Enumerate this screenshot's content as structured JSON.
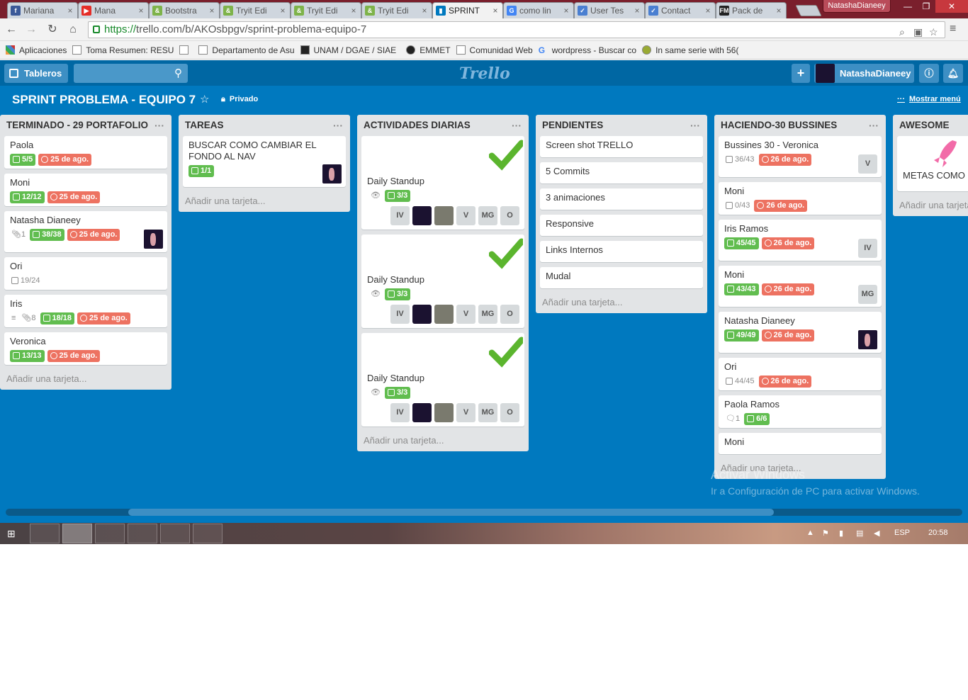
{
  "browser": {
    "tabs": [
      {
        "title": "Mariana",
        "fav": "f",
        "favcolor": "#3b5998"
      },
      {
        "title": "Mana",
        "fav": "▶",
        "favcolor": "#e52d27"
      },
      {
        "title": "Bootstra",
        "fav": "&",
        "favcolor": "#7eb34a"
      },
      {
        "title": "Tryit Edi",
        "fav": "&",
        "favcolor": "#7eb34a"
      },
      {
        "title": "Tryit Edi",
        "fav": "&",
        "favcolor": "#7eb34a"
      },
      {
        "title": "Tryit Edi",
        "fav": "&",
        "favcolor": "#7eb34a"
      },
      {
        "title": "SPRINT",
        "fav": "▮",
        "favcolor": "#0079bf"
      },
      {
        "title": "como lin",
        "fav": "G",
        "favcolor": "#4285f4"
      },
      {
        "title": "User Tes",
        "fav": "✓",
        "favcolor": "#4a7fd1"
      },
      {
        "title": "Contact",
        "fav": "✓",
        "favcolor": "#4a7fd1"
      },
      {
        "title": "Pack de",
        "fav": "FM",
        "favcolor": "#222222"
      }
    ],
    "profile_name": "NatashaDianeey",
    "url_scheme": "https://",
    "url_rest": "trello.com/b/AKOsbpgv/sprint-problema-equipo-7",
    "bookmarks": [
      "Aplicaciones",
      "Toma Resumen: RESU",
      "",
      "Departamento de Asu",
      "UNAM / DGAE / SIAE",
      "EMMET",
      "Comunidad Web",
      "wordpress - Buscar co",
      "In same serie with 56("
    ]
  },
  "trello": {
    "boards_label": "Tableros",
    "logo": "Trello",
    "user": "NatashaDianeey",
    "board_title": "SPRINT PROBLEMA - EQUIPO 7",
    "privacy": "Privado",
    "show_menu": "Mostrar menú",
    "add_card": "Añadir una tarjeta...",
    "lists": [
      {
        "title": "TERMINADO - 29 PORTAFOLIO",
        "cards": [
          {
            "title": "Paola",
            "check": "5/5",
            "due": "25 de ago."
          },
          {
            "title": "Moni",
            "check": "12/12",
            "due": "25 de ago."
          },
          {
            "title": "Natasha Dianeey",
            "attach": "1",
            "check": "38/38",
            "due": "25 de ago."
          },
          {
            "title": "Ori",
            "check_plain": "19/24"
          },
          {
            "title": "Iris",
            "attach": "8",
            "check": "18/18",
            "due": "25 de ago."
          },
          {
            "title": "Veronica",
            "check": "13/13",
            "due": "25 de ago."
          }
        ]
      },
      {
        "title": "TAREAS",
        "cards": [
          {
            "title": "BUSCAR COMO CAMBIAR EL FONDO AL NAV",
            "check": "1/1"
          }
        ]
      },
      {
        "title": "ACTIVIDADES DIARIAS",
        "cards": [
          {
            "title": "Daily Standup",
            "check": "3/3",
            "members": [
              "IV",
              "",
              "",
              "V",
              "MG",
              "O"
            ]
          },
          {
            "title": "Daily Standup",
            "check": "3/3",
            "members": [
              "IV",
              "",
              "",
              "V",
              "MG",
              "O"
            ]
          },
          {
            "title": "Daily Standup",
            "check": "3/3",
            "members": [
              "IV",
              "",
              "",
              "V",
              "MG",
              "O"
            ]
          }
        ]
      },
      {
        "title": "PENDIENTES",
        "cards": [
          {
            "title": "Screen shot TRELLO"
          },
          {
            "title": "5 Commits"
          },
          {
            "title": "3 animaciones"
          },
          {
            "title": "Responsive"
          },
          {
            "title": "Links Internos"
          },
          {
            "title": "Mudal"
          }
        ]
      },
      {
        "title": "HACIENDO-30 BUSSINES",
        "cards": [
          {
            "title": "Bussines 30 - Veronica",
            "check_plain": "36/43",
            "due": "26 de ago.",
            "member": "V"
          },
          {
            "title": "Moni",
            "check_plain": "0/43",
            "due": "26 de ago."
          },
          {
            "title": "Iris Ramos",
            "check": "45/45",
            "due": "26 de ago.",
            "member": "IV"
          },
          {
            "title": "Moni",
            "check": "43/43",
            "due": "26 de ago.",
            "member": "MG"
          },
          {
            "title": "Natasha Dianeey",
            "check": "49/49",
            "due": "26 de ago."
          },
          {
            "title": "Ori",
            "check_plain": "44/45",
            "due": "26 de ago."
          },
          {
            "title": "Paola Ramos",
            "comments": "1",
            "check": "6/6"
          },
          {
            "title": "Moni"
          }
        ]
      },
      {
        "title": "AWESOME",
        "cards": [
          {
            "title": "METAS COMO E"
          }
        ]
      }
    ],
    "watermark1": "Activar Windows",
    "watermark2": "Ir a Configuración de PC para activar Windows."
  },
  "taskbar": {
    "lang": "ESP",
    "time": "20:58"
  }
}
